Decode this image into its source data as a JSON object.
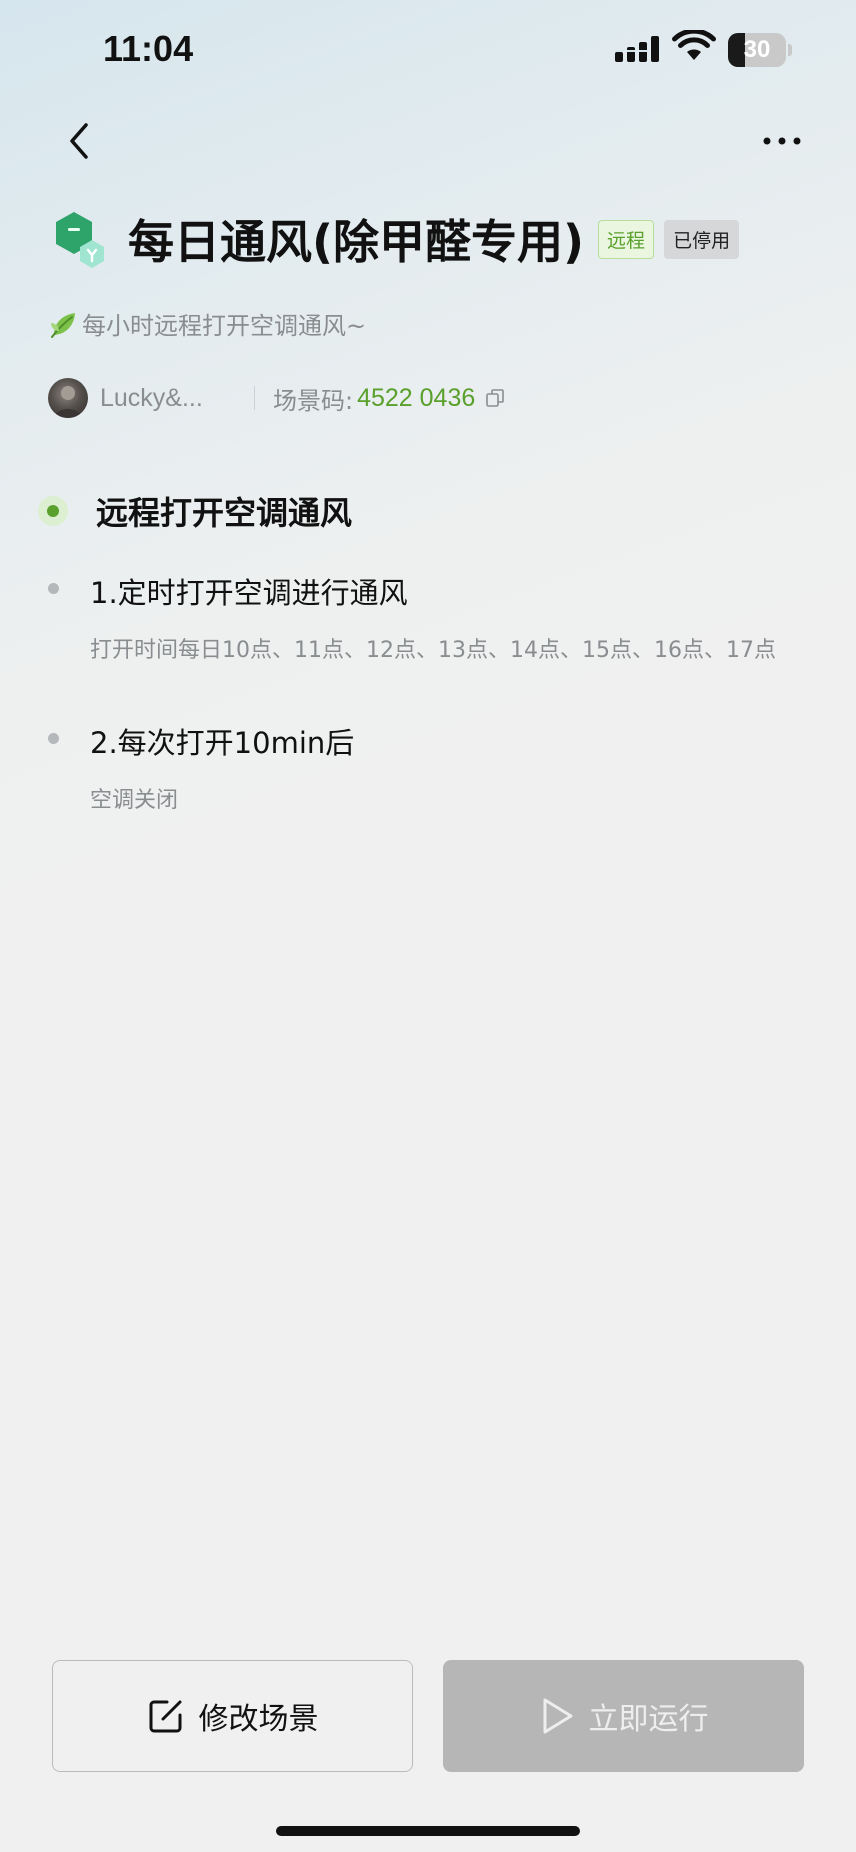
{
  "status_bar": {
    "time": "11:04",
    "battery_level": "30",
    "battery_fraction": 0.3
  },
  "icons": {
    "back": "chevron-left-icon",
    "more": "more-horizontal-icon",
    "scene": "scene-cube-icon",
    "leaf": "leaf-icon",
    "copy": "copy-icon",
    "edit": "edit-icon",
    "play": "play-icon"
  },
  "colors": {
    "accent_green": "#5aa02c",
    "muted_text": "#8a8d90",
    "disabled_button": "#b6b6b6"
  },
  "scene": {
    "title": "每日通风(除甲醛专用)",
    "tag_remote": "远程",
    "tag_status": "已停用",
    "description": "每小时远程打开空调通风~",
    "author": "Lucky&...",
    "code_label": "场景码:",
    "code_value": "4522 0436"
  },
  "section": {
    "title": "远程打开空调通风"
  },
  "steps": [
    {
      "title": "1.定时打开空调进行通风",
      "description": "打开时间每日10点、11点、12点、13点、14点、15点、16点、17点"
    },
    {
      "title": "2.每次打开10min后",
      "description": "空调关闭"
    }
  ],
  "actions": {
    "edit_label": "修改场景",
    "run_label": "立即运行"
  }
}
